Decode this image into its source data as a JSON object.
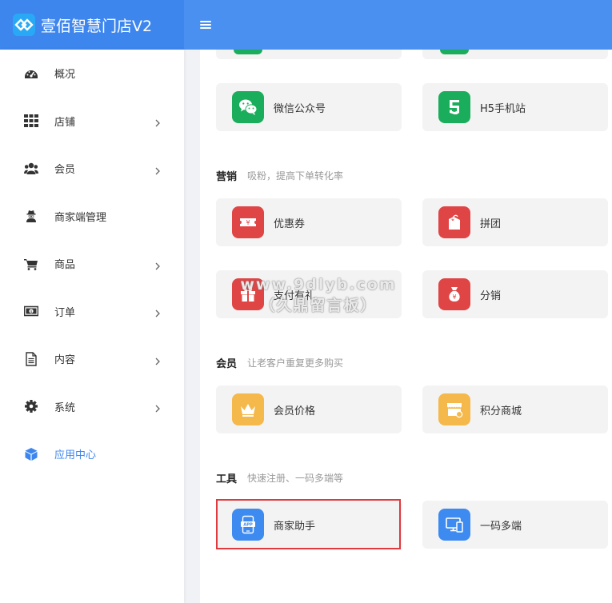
{
  "header": {
    "brand": "壹佰智慧门店V2",
    "menu_icon": "hamburger-icon"
  },
  "sidebar": {
    "items": [
      {
        "label": "概况",
        "icon": "dashboard-icon",
        "has_children": false,
        "active": false
      },
      {
        "label": "店铺",
        "icon": "grid-icon",
        "has_children": true,
        "active": false
      },
      {
        "label": "会员",
        "icon": "users-icon",
        "has_children": true,
        "active": false
      },
      {
        "label": "商家端管理",
        "icon": "user-secret-icon",
        "has_children": false,
        "active": false
      },
      {
        "label": "商品",
        "icon": "cart-icon",
        "has_children": true,
        "active": false
      },
      {
        "label": "订单",
        "icon": "money-icon",
        "has_children": true,
        "active": false
      },
      {
        "label": "内容",
        "icon": "document-icon",
        "has_children": true,
        "active": false
      },
      {
        "label": "系统",
        "icon": "gear-icon",
        "has_children": true,
        "active": false
      },
      {
        "label": "应用中心",
        "icon": "cube-icon",
        "has_children": false,
        "active": true
      }
    ],
    "active_color": "#3d86ee"
  },
  "main": {
    "channel_cards": [
      {
        "label": "微信公众号",
        "icon": "wechat-icon",
        "color": "#1aad5b"
      },
      {
        "label": "H5手机站",
        "icon": "html5-icon",
        "color": "#1aad5b"
      }
    ],
    "sections": [
      {
        "title": "营销",
        "subtitle": "吸粉，提高下单转化率",
        "cards": [
          {
            "label": "优惠券",
            "icon": "coupon-icon",
            "color": "#e04546"
          },
          {
            "label": "拼团",
            "icon": "tag-icon",
            "color": "#e04546"
          },
          {
            "label": "支付有礼",
            "icon": "gift-icon",
            "color": "#e04546"
          },
          {
            "label": "分销",
            "icon": "money-bag-icon",
            "color": "#e04546"
          }
        ]
      },
      {
        "title": "会员",
        "subtitle": "让老客户重复更多购买",
        "cards": [
          {
            "label": "会员价格",
            "icon": "crown-icon",
            "color": "#f5b84a"
          },
          {
            "label": "积分商城",
            "icon": "points-shop-icon",
            "color": "#f5b84a"
          }
        ]
      },
      {
        "title": "工具",
        "subtitle": "快速注册、一码多端等",
        "cards": [
          {
            "label": "商家助手",
            "icon": "app-icon",
            "color": "#3d8bf0",
            "highlighted": true
          },
          {
            "label": "一码多端",
            "icon": "multi-device-icon",
            "color": "#3d8bf0"
          }
        ]
      }
    ]
  },
  "watermark": {
    "line1": "www.9dlyb.com",
    "line2": "（久鼎留言板）"
  }
}
